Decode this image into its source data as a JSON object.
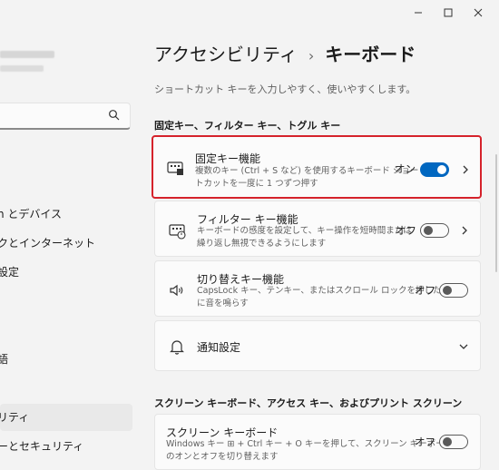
{
  "sidebar": {
    "search_placeholder": "",
    "items": [
      {
        "label": "h とデバイス"
      },
      {
        "label": "クとインターネット"
      },
      {
        "label": "設定"
      },
      {
        "label": "語"
      },
      {
        "label": "リティ"
      },
      {
        "label": "ーとセキュリティ"
      }
    ]
  },
  "header": {
    "breadcrumb_parent": "アクセシビリティ",
    "breadcrumb_separator": "›",
    "breadcrumb_current": "キーボード",
    "description": "ショートカット キーを入力しやすく、使いやすくします。"
  },
  "sections": {
    "sticky_section_title": "固定キー、フィルター キー、トグル キー",
    "screen_section_title": "スクリーン キーボード、アクセス キー、およびプリント スクリーン"
  },
  "cards": {
    "sticky": {
      "title": "固定キー機能",
      "desc_line1": "複数のキー (Ctrl + S など) を使用するキーボード ショー",
      "desc_line2": "トカットを一度に 1 つずつ押す",
      "state": "オン"
    },
    "filter": {
      "title": "フィルター キー機能",
      "desc_line1": "キーボードの感度を設定して、キー操作を短時間または",
      "desc_line2": "繰り返し無視できるようにします",
      "state": "オフ"
    },
    "toggle": {
      "title": "切り替えキー機能",
      "desc_line1": "CapsLock キー、テンキー、またはスクロール ロックを押したとき",
      "desc_line2": "に音を鳴らす",
      "state": "オフ"
    },
    "notify": {
      "title": "通知設定"
    },
    "osk": {
      "title": "スクリーン キーボード",
      "desc_line1": "Windows キー ⊞ + Ctrl キー + O キーを押して、スクリーン キーボード",
      "desc_line2": "のオンとオフを切り替えます",
      "state": "オフ"
    }
  },
  "colors": {
    "accent": "#0067c0",
    "highlight_border": "#d5222b",
    "background": "#f3f3f3",
    "card": "#fbfbfb"
  }
}
